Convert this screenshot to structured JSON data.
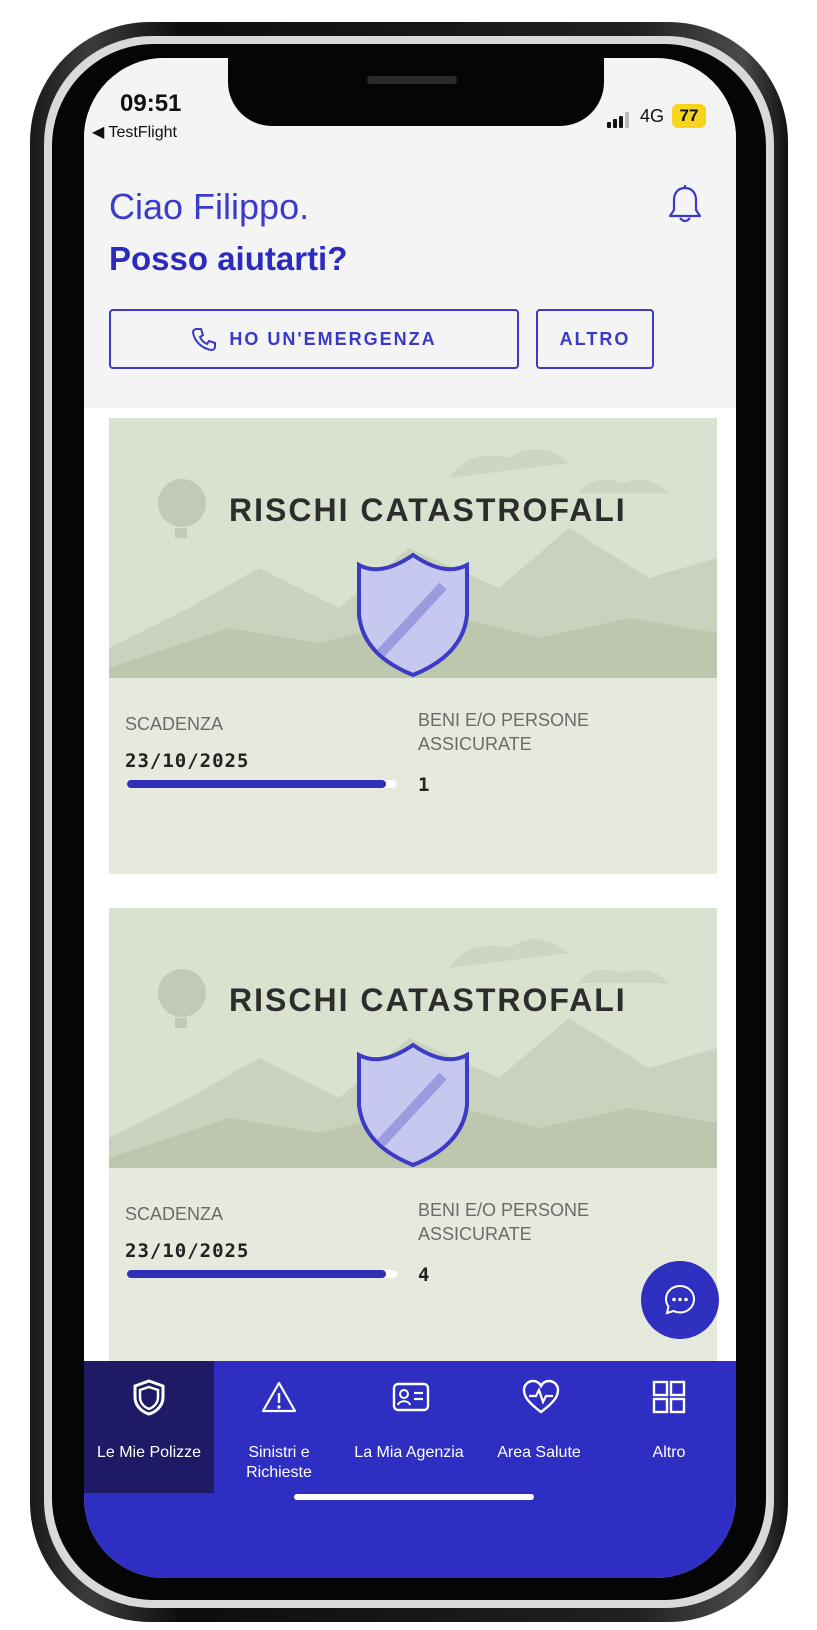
{
  "status": {
    "time": "09:51",
    "back_app": "◀ TestFlight",
    "network": "4G",
    "battery": "77"
  },
  "header": {
    "greeting": "Ciao Filippo.",
    "question": "Posso aiutarti?"
  },
  "actions": {
    "emergency": "HO UN'EMERGENZA",
    "more": "ALTRO"
  },
  "policies": [
    {
      "title": "RISCHI CATASTROFALI",
      "expiry_label": "SCADENZA",
      "expiry": "23/10/2025",
      "insured_label": "BENI E/O PERSONE ASSICURATE",
      "insured_count": "1",
      "progress": 0.96
    },
    {
      "title": "RISCHI CATASTROFALI",
      "expiry_label": "SCADENZA",
      "expiry": "23/10/2025",
      "insured_label": "BENI E/O PERSONE ASSICURATE",
      "insured_count": "4",
      "progress": 0.96
    }
  ],
  "tabs": [
    {
      "label": "Le Mie Polizze",
      "icon": "shield-icon",
      "active": true
    },
    {
      "label": "Sinistri e Richieste",
      "icon": "warning-icon",
      "active": false
    },
    {
      "label": "La Mia Agenzia",
      "icon": "id-card-icon",
      "active": false
    },
    {
      "label": "Area Salute",
      "icon": "heart-pulse-icon",
      "active": false
    },
    {
      "label": "Altro",
      "icon": "grid-icon",
      "active": false
    }
  ],
  "colors": {
    "primary": "#2e2ec2",
    "active_tab": "#1e1a66",
    "card_bg": "#e5eadd",
    "battery": "#f7d51d"
  }
}
